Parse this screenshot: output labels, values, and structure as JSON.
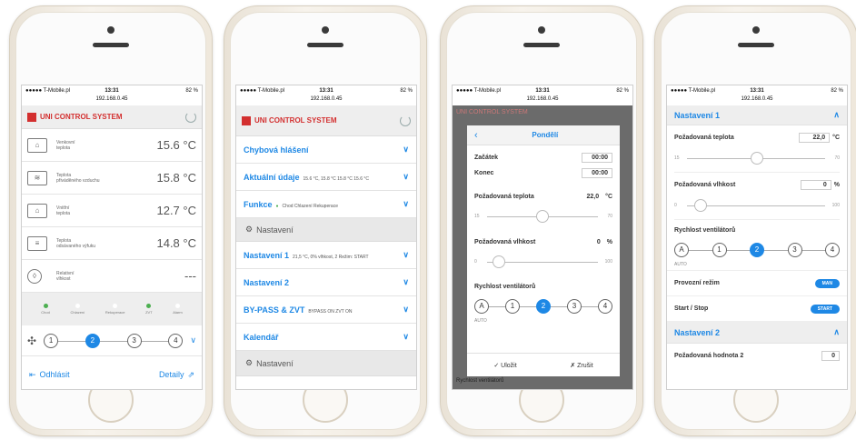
{
  "status": {
    "carrier": "●●●●● T-Mobile.pl",
    "time": "13:31",
    "url": "192.168.0.45",
    "battery": "82 %"
  },
  "brand": "UNI CONTROL SYSTEM",
  "screen1": {
    "rows": [
      {
        "label1": "Venkovní",
        "label2": "teplota",
        "value": "15.6 °C"
      },
      {
        "label1": "Teplota",
        "label2": "přiváděného vzduchu",
        "value": "15.8 °C"
      },
      {
        "label1": "Vnitřní",
        "label2": "teplota",
        "value": "12.7 °C"
      },
      {
        "label1": "Teplota",
        "label2": "odsávaného výfuku",
        "value": "14.8 °C"
      },
      {
        "label1": "Relativní",
        "label2": "vlhkost",
        "value": "---"
      }
    ],
    "indicators": [
      "Chod",
      "Chlazení",
      "Rekuperace",
      "ZVT",
      "Alarm"
    ],
    "fan": [
      "1",
      "2",
      "3",
      "4"
    ],
    "logout": "Odhlásit",
    "details": "Detaily"
  },
  "screen2": {
    "sections": [
      {
        "title": "Chybová hlášení",
        "extra": ""
      },
      {
        "title": "Aktuální údaje",
        "extra": "15.6 °C, 15.8 °C 15.8 °C 15.6 °C"
      },
      {
        "title": "Funkce",
        "extra": "Chod   Chlazení   Rekuperace"
      },
      {
        "title": "Nastavení 1",
        "extra": "21,5 °C, 0% vlhkost, 2 Režim: START"
      },
      {
        "title": "Nastavení 2",
        "extra": ""
      },
      {
        "title": "BY-PASS & ZVT",
        "extra": "BYPASS ON ZVT ON"
      },
      {
        "title": "Kalendář",
        "extra": ""
      }
    ],
    "settings_label": "Nastavení"
  },
  "screen3": {
    "title": "Pondělí",
    "start_label": "Začátek",
    "start_value": "00:00",
    "end_label": "Konec",
    "end_value": "00:00",
    "temp_label": "Požadovaná teplota",
    "temp_value": "22,0",
    "temp_unit": "°C",
    "temp_min": "15",
    "temp_max": "70",
    "hum_label": "Požadovaná vlhkost",
    "hum_value": "0",
    "hum_unit": "%",
    "hum_min": "0",
    "hum_max": "100",
    "fan_label": "Rychlost ventilátorů",
    "fan": [
      "A",
      "1",
      "2",
      "3",
      "4"
    ],
    "auto": "AUTO",
    "save": "✓ Uložit",
    "cancel": "✗ Zrušit",
    "behind": "Rychlost ventilátorů"
  },
  "screen4": {
    "section1": "Nastavení 1",
    "temp_label": "Požadovaná teplota",
    "temp_value": "22,0",
    "temp_unit": "°C",
    "temp_min": "15",
    "temp_max": "70",
    "hum_label": "Požadovaná vlhkost",
    "hum_value": "0",
    "hum_unit": "%",
    "hum_min": "0",
    "hum_max": "100",
    "fan_label": "Rychlost ventilátorů",
    "fan": [
      "A",
      "1",
      "2",
      "3",
      "4"
    ],
    "auto": "AUTO",
    "mode_label": "Provozní režim",
    "mode_btn": "MAN",
    "start_label": "Start / Stop",
    "start_btn": "START",
    "section2": "Nastavení 2",
    "val2_label": "Požadovaná hodnota 2",
    "val2": "0"
  }
}
